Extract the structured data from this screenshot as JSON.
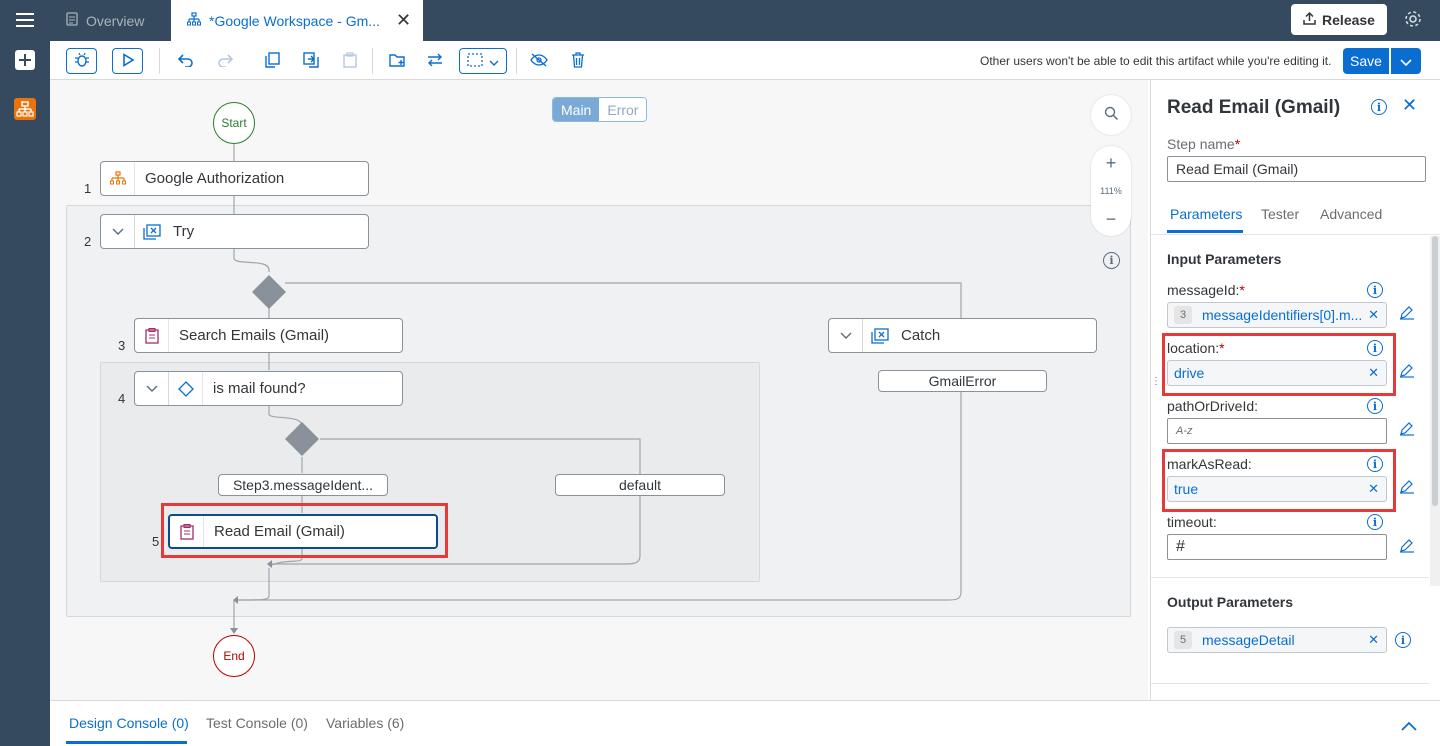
{
  "tabs": {
    "overview": "Overview",
    "active": "*Google Workspace - Gm..."
  },
  "header": {
    "release_label": "Release"
  },
  "toolbar": {
    "lock_message": "Other users won't be able to edit this artifact while you're editing it.",
    "save_label": "Save"
  },
  "canvas": {
    "segments": [
      "Main",
      "Error"
    ],
    "start_label": "Start",
    "end_label": "End",
    "zoom_level": "111%",
    "steps": [
      {
        "num": "1",
        "label": "Google Authorization"
      },
      {
        "num": "2",
        "label": "Try"
      },
      {
        "num": "3",
        "label": "Search Emails (Gmail)"
      },
      {
        "num": "4",
        "label": "is mail found?"
      },
      {
        "num": "5",
        "label": "Read Email (Gmail)"
      }
    ],
    "catch_label": "Catch",
    "gmail_error": "GmailError",
    "branch_condition": "Step3.messageIdent...",
    "branch_default": "default"
  },
  "panel": {
    "title": "Read Email (Gmail)",
    "step_name_label": "Step name",
    "step_name_value": "Read Email (Gmail)",
    "tabs": [
      "Parameters",
      "Tester",
      "Advanced"
    ],
    "input_heading": "Input Parameters",
    "params": {
      "message_id_label": "messageId:",
      "message_id_step": "3",
      "message_id_value": "messageIdentifiers[0].m...",
      "location_label": "location:",
      "location_value": "drive",
      "path_label": "pathOrDriveId:",
      "path_placeholder": "A-z",
      "mark_label": "markAsRead:",
      "mark_value": "true",
      "timeout_label": "timeout:",
      "timeout_placeholder": "#"
    },
    "output_heading": "Output Parameters",
    "output_step": "5",
    "output_value": "messageDetail"
  },
  "bottom_tabs": [
    "Design Console (0)",
    "Test Console (0)",
    "Variables (6)"
  ],
  "colors": {
    "shell": "#354a5f",
    "accent": "#0a6ed1",
    "highlight": "#e5393a",
    "start": "#2b7d2b",
    "end": "#bb0000"
  }
}
